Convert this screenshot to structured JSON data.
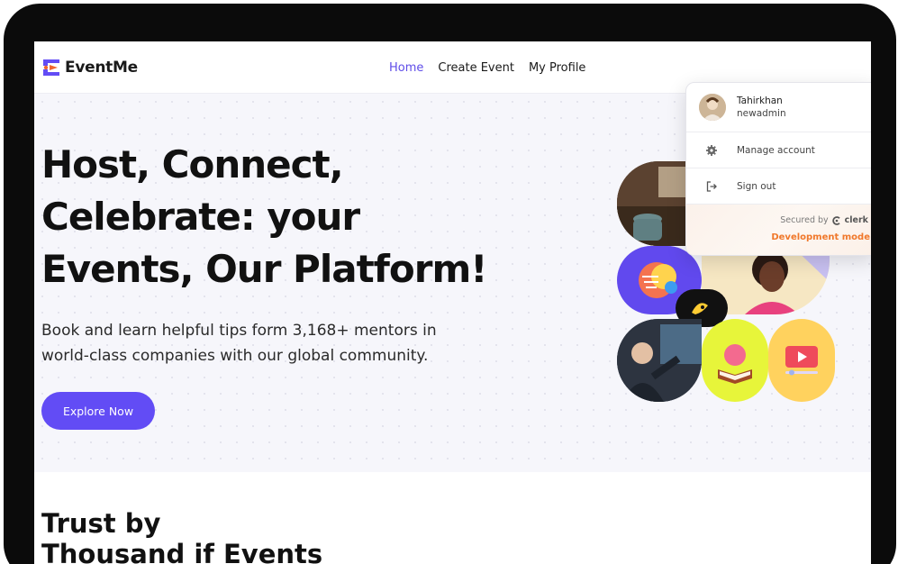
{
  "brand": {
    "name": "EventMe",
    "accent": "#5f4de8",
    "logo_colors": [
      "#624cf5",
      "#f0652f"
    ]
  },
  "nav": {
    "items": [
      {
        "label": "Home",
        "active": true
      },
      {
        "label": "Create Event",
        "active": false
      },
      {
        "label": "My Profile",
        "active": false
      }
    ]
  },
  "hero": {
    "title_lines": [
      "Host, Connect,",
      "Celebrate: your",
      "Events, Our Platform!"
    ],
    "subtitle_lines": [
      "Book and learn helpful tips form 3,168+ mentors in",
      "world-class companies with our global community."
    ],
    "cta_label": "Explore Now",
    "cta_color": "#624cf5"
  },
  "collage": {
    "tiles": [
      "coffee-photo",
      "brain-gear-icon",
      "smiling-woman-photo",
      "chat-bubble-icon",
      "presenter-photo",
      "brain-book-icon",
      "video-play-icon"
    ]
  },
  "trust": {
    "lines": [
      "Trust by",
      "Thousand if Events"
    ]
  },
  "user_menu": {
    "username": "Tahirkhan",
    "handle": "newadmin",
    "manage_label": "Manage account",
    "signout_label": "Sign out",
    "secured_by": "Secured by",
    "provider": "clerk",
    "dev_mode": "Development mode",
    "dev_mode_color": "#f0782b"
  }
}
